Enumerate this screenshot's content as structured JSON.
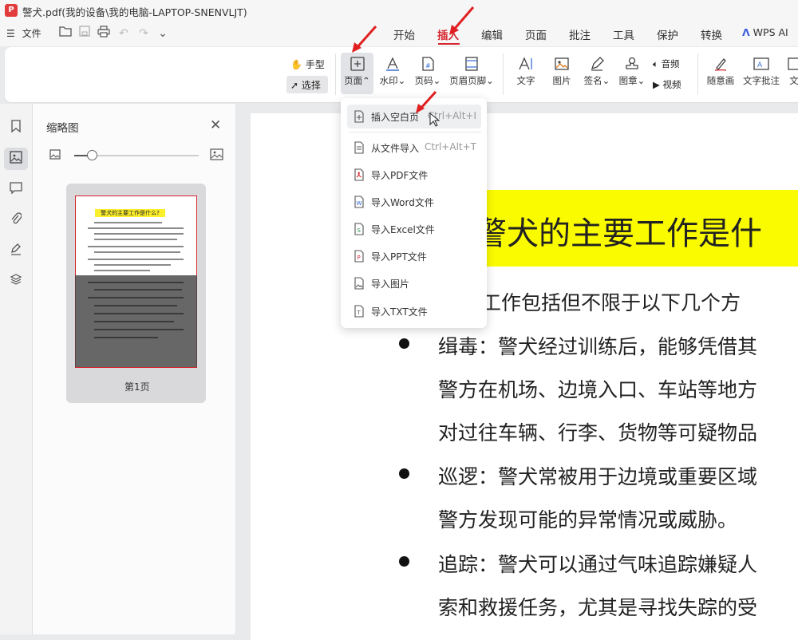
{
  "title_bar": {
    "app_icon": "P",
    "title": "警犬.pdf(我的设备\\我的电脑-LAPTOP-SNENVLJT)"
  },
  "menu": {
    "file_label": "文件",
    "tabs": [
      "开始",
      "插入",
      "编辑",
      "页面",
      "批注",
      "工具",
      "保护",
      "转换"
    ],
    "active_tab": "插入",
    "wps_ai": "WPS AI"
  },
  "ribbon": {
    "hand": "手型",
    "select": "选择",
    "page": "页面",
    "watermark": "水印",
    "page_number": "页码",
    "header_footer": "页眉页脚",
    "text": "文字",
    "image": "图片",
    "sign": "签名",
    "stamp": "图章",
    "audio": "音频",
    "video": "视频",
    "freehand": "随意画",
    "text_comment": "文字批注",
    "more": "文"
  },
  "thumbnail_panel": {
    "title": "缩略图",
    "thumb_heading": "警犬的主要工作是什么?",
    "page_label": "第1页"
  },
  "dropdown": {
    "items": [
      {
        "label": "插入空白页",
        "shortcut": "Ctrl+Alt+I",
        "icon": "blank-page-icon"
      },
      {
        "label": "从文件导入",
        "shortcut": "Ctrl+Alt+T",
        "icon": "file-import-icon"
      },
      {
        "label": "导入PDF文件",
        "shortcut": "",
        "icon": "pdf-file-icon"
      },
      {
        "label": "导入Word文件",
        "shortcut": "",
        "icon": "word-file-icon"
      },
      {
        "label": "导入Excel文件",
        "shortcut": "",
        "icon": "excel-file-icon"
      },
      {
        "label": "导入PPT文件",
        "shortcut": "",
        "icon": "ppt-file-icon"
      },
      {
        "label": "导入图片",
        "shortcut": "",
        "icon": "image-file-icon"
      },
      {
        "label": "导入TXT文件",
        "shortcut": "",
        "icon": "txt-file-icon"
      }
    ]
  },
  "document": {
    "heading": "警犬的主要工作是什",
    "intro": "要工作包括但不限于以下几个方",
    "lines": [
      "缉毒：警犬经过训练后，能够凭借其",
      "警方在机场、边境入口、车站等地方",
      "对过往车辆、行李、货物等可疑物品",
      "巡逻：警犬常被用于边境或重要区域",
      "警方发现可能的异常情况或威胁。",
      "追踪：警犬可以通过气味追踪嫌疑人",
      "索和救援任务，尤其是寻找失踪的受"
    ]
  },
  "colors": {
    "accent": "#d6262e",
    "highlight": "#fbfb00"
  }
}
